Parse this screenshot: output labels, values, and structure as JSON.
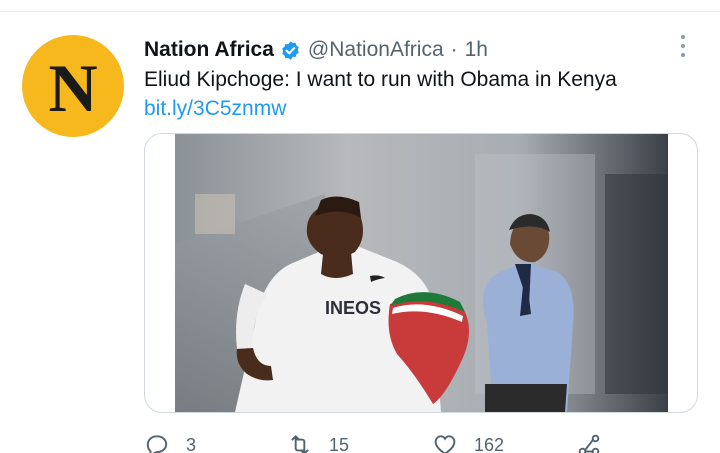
{
  "tweet": {
    "avatar_letter": "N",
    "display_name": "Nation Africa",
    "handle": "@NationAfrica",
    "separator": "·",
    "time": "1h",
    "text": "Eliud Kipchoge: I want to run with Obama in Kenya",
    "link": "bit.ly/3C5znmw",
    "shirt_text": "INEOS"
  },
  "actions": {
    "replies": "3",
    "retweets": "15",
    "likes": "162"
  },
  "colors": {
    "avatar_bg": "#f7b81d",
    "link": "#1d9bf0",
    "verified": "#1d9bf0",
    "muted": "#536471"
  },
  "icons": [
    "verified-badge-icon",
    "more-icon",
    "reply-icon",
    "retweet-icon",
    "like-icon",
    "share-icon"
  ]
}
